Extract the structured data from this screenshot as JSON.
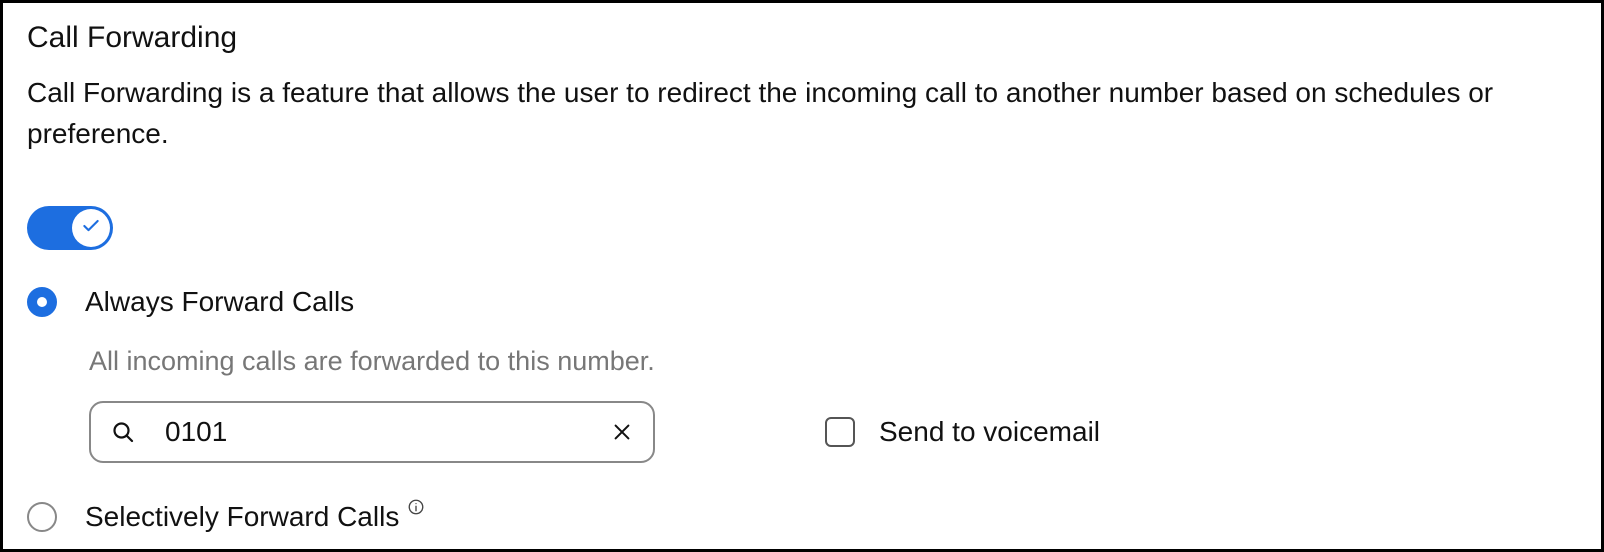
{
  "title": "Call Forwarding",
  "description": "Call Forwarding is a feature that allows the user to redirect the incoming call to another number based on schedules or preference.",
  "toggle": {
    "enabled": true,
    "accent_color": "#1d6ee0"
  },
  "options": {
    "always": {
      "label": "Always Forward Calls",
      "selected": true,
      "sub_desc": "All incoming calls are forwarded to this number.",
      "number_value": "0101",
      "number_placeholder": ""
    },
    "selective": {
      "label": "Selectively Forward Calls",
      "selected": false
    }
  },
  "voicemail": {
    "label": "Send to voicemail",
    "checked": false
  }
}
